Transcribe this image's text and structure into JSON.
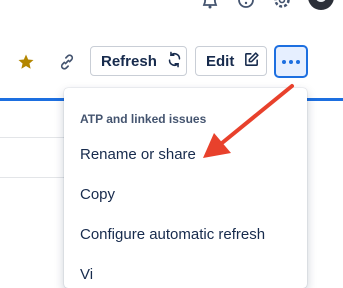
{
  "toolbar": {
    "refresh_label": "Refresh",
    "edit_label": "Edit",
    "star_color": "#b38600",
    "accent_color": "#1d6fe0"
  },
  "menu": {
    "heading": "ATP and linked issues",
    "items": [
      "Rename or share",
      "Copy",
      "Configure automatic refresh",
      "View as... (partially visible)"
    ]
  },
  "annotation": {
    "arrow_color": "#e8412c",
    "arrow_target": "Rename or share"
  },
  "icons": [
    "bell-icon",
    "help-icon",
    "gear-icon",
    "avatar",
    "star-icon",
    "link-icon",
    "refresh-icon",
    "edit-icon",
    "more-icon"
  ]
}
